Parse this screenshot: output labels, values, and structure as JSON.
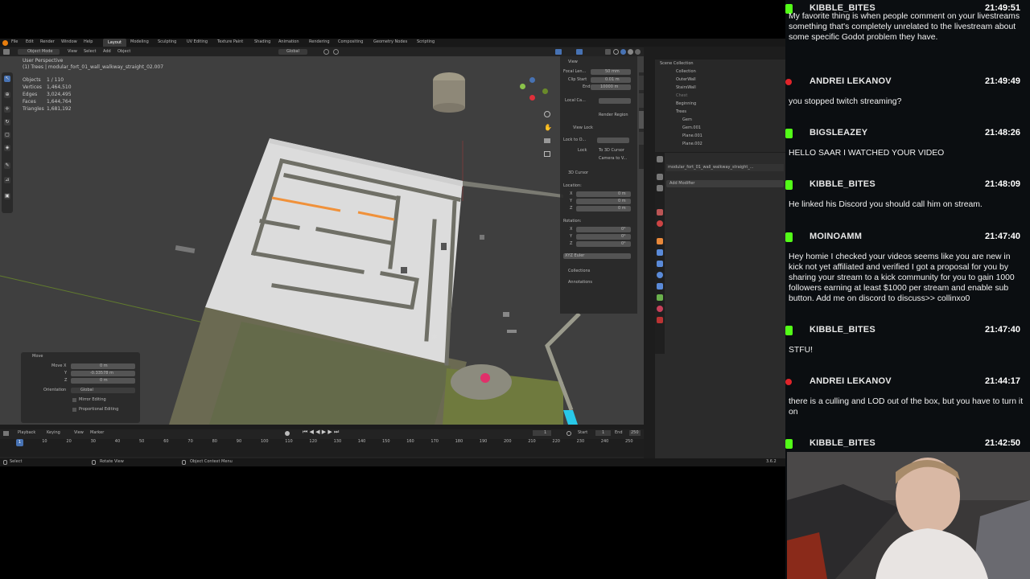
{
  "blender": {
    "menu": [
      "File",
      "Edit",
      "Render",
      "Window",
      "Help"
    ],
    "workspaces": [
      "Layout",
      "Modeling",
      "Sculpting",
      "UV Editing",
      "Texture Paint",
      "Shading",
      "Animation",
      "Rendering",
      "Compositing",
      "Geometry Nodes",
      "Scripting"
    ],
    "header": {
      "mode": "Object Mode",
      "menus": [
        "View",
        "Select",
        "Add",
        "Object"
      ],
      "orientation": "Global"
    },
    "overlay": {
      "view_name": "User Perspective",
      "collection_path": "(1) Trees | modular_fort_01_wall_walkway_straight_02.007",
      "stats": [
        {
          "label": "Objects",
          "value": "1 / 110"
        },
        {
          "label": "Vertices",
          "value": "1,464,510"
        },
        {
          "label": "Edges",
          "value": "3,024,495"
        },
        {
          "label": "Faces",
          "value": "1,644,764"
        },
        {
          "label": "Triangles",
          "value": "1,681,192"
        }
      ]
    },
    "npanel": {
      "view_title": "View",
      "focal_label": "Focal Len...",
      "focal_value": "50 mm",
      "clip_start_label": "Clip Start",
      "clip_start_value": "0.01 m",
      "end_label": "End",
      "end_value": "10000 m",
      "local_camera": "Local Ca...",
      "render_region": "Render Region",
      "view_lock": "View Lock",
      "lock_to": "Lock to O...",
      "lock": "Lock",
      "to_cursor": "To 3D Cursor",
      "camera_to_view": "Camera to V...",
      "cursor_title": "3D Cursor",
      "location": "Location:",
      "x": "X",
      "y": "Y",
      "z": "Z",
      "loc_x": "0 m",
      "loc_y": "0 m",
      "loc_z": "0 m",
      "rotation": "Rotation:",
      "rot_x": "0°",
      "rot_y": "0°",
      "rot_z": "0°",
      "euler": "XYZ Euler",
      "collections": "Collections",
      "annotations": "Annotations"
    },
    "move_panel": {
      "title": "Move",
      "move_x_label": "Move X",
      "move_x": "0 m",
      "y_label": "Y",
      "y": "-0.33578 m",
      "z_label": "Z",
      "z": "0 m",
      "orientation_label": "Orientation",
      "orientation": "Global",
      "mirror": "Mirror Editing",
      "proportional": "Proportional Editing"
    },
    "outliner": {
      "title": "Scene Collection",
      "items": [
        "Collection",
        "OuterWall",
        "StairsWall",
        "Chest",
        "Beginning",
        "Trees",
        "Gem",
        "Gem.001",
        "Plane.001",
        "Plane.002"
      ]
    },
    "properties": {
      "object": "modular_fort_01_wall_walkway_straight_...",
      "add_modifier": "Add Modifier"
    },
    "timeline": {
      "menus": [
        "Playback",
        "Keying",
        "View",
        "Marker"
      ],
      "current_frame": "1",
      "start_label": "Start",
      "start": "1",
      "end_label": "End",
      "end": "250",
      "ticks": [
        "0",
        "10",
        "20",
        "30",
        "40",
        "50",
        "60",
        "70",
        "80",
        "90",
        "100",
        "110",
        "120",
        "130",
        "140",
        "150",
        "160",
        "170",
        "180",
        "190",
        "200",
        "210",
        "220",
        "230",
        "240",
        "250"
      ]
    },
    "status": {
      "select": "Select",
      "rotate": "Rotate View",
      "context": "Object Context Menu",
      "version": "3.6.2"
    }
  },
  "chat": [
    {
      "user": "KIBBLE_BITES",
      "time": "21:49:51",
      "badge": "kick",
      "text": "My favorite thing is when people comment on your livestreams something that's completely unrelated to the livestream about some specific Godot problem they have."
    },
    {
      "user": "ANDREI LEKANOV",
      "time": "21:49:49",
      "badge": "red",
      "text": "you stopped twitch streaming?"
    },
    {
      "user": "BIGSLEAZEY",
      "time": "21:48:26",
      "badge": "kick",
      "text": "HELLO SAAR I WATCHED YOUR VIDEO"
    },
    {
      "user": "KIBBLE_BITES",
      "time": "21:48:09",
      "badge": "kick",
      "text": "He linked his Discord you should call him on stream."
    },
    {
      "user": "MOINOAMM",
      "time": "21:47:40",
      "badge": "kick",
      "text": "Hey homie I checked your videos seems like you are new in kick not yet affiliated and verified I got a proposal for you by sharing your stream to a kick community for you to gain 1000 followers earning at least $1000 per stream and enable sub button. Add me on discord to discuss>> collinxo0"
    },
    {
      "user": "KIBBLE_BITES",
      "time": "21:47:40",
      "badge": "kick",
      "text": "STFU!"
    },
    {
      "user": "ANDREI LEKANOV",
      "time": "21:44:17",
      "badge": "red",
      "text": "there is a culling and LOD out of the box, but you have to turn it on"
    },
    {
      "user": "KIBBLE_BITES",
      "time": "21:42:50",
      "badge": "kick",
      "text": ""
    }
  ],
  "colors": {
    "kick_green": "#53fc18",
    "accent_blue": "#4772b3",
    "selection_orange": "#f0913a"
  }
}
